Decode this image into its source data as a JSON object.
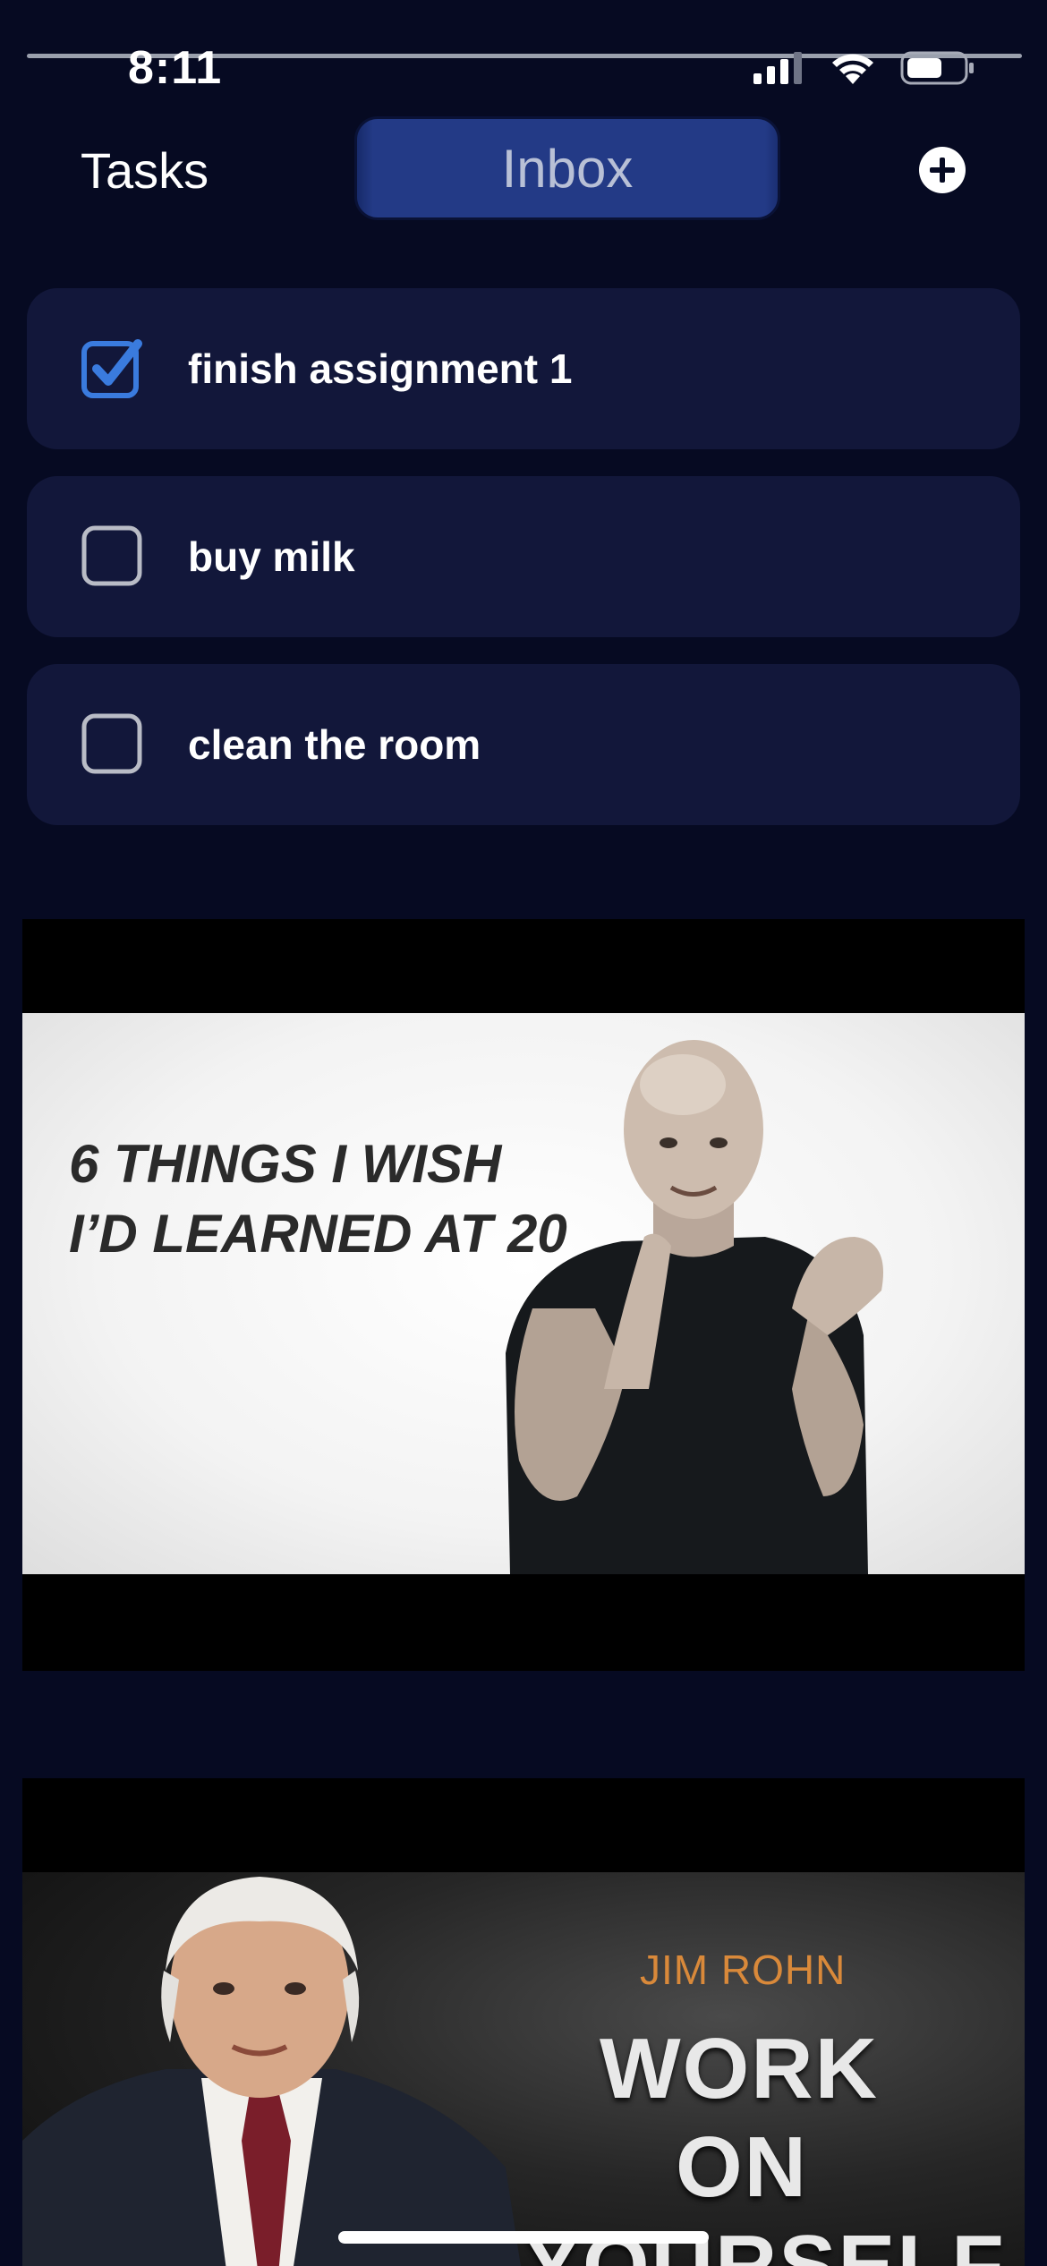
{
  "status_bar": {
    "time": "8:11"
  },
  "header": {
    "title": "Tasks",
    "tab_label": "Inbox",
    "add_icon": "plus-circle-icon"
  },
  "tasks": [
    {
      "label": "finish assignment 1",
      "checked": true
    },
    {
      "label": "buy milk",
      "checked": false
    },
    {
      "label": "clean the room",
      "checked": false
    }
  ],
  "videos": [
    {
      "title_line1": "6 THINGS I WISH",
      "title_line2": "I’D LEARNED AT 20"
    },
    {
      "name": "JIM ROHN",
      "word1": "WORK",
      "word2": "ON",
      "word3": "YOURSELF"
    }
  ],
  "colors": {
    "background": "#060a22",
    "card": "#12173a",
    "accent_blue": "#3a7bde",
    "pill": "#233a86",
    "jim_orange": "#d9893a"
  }
}
